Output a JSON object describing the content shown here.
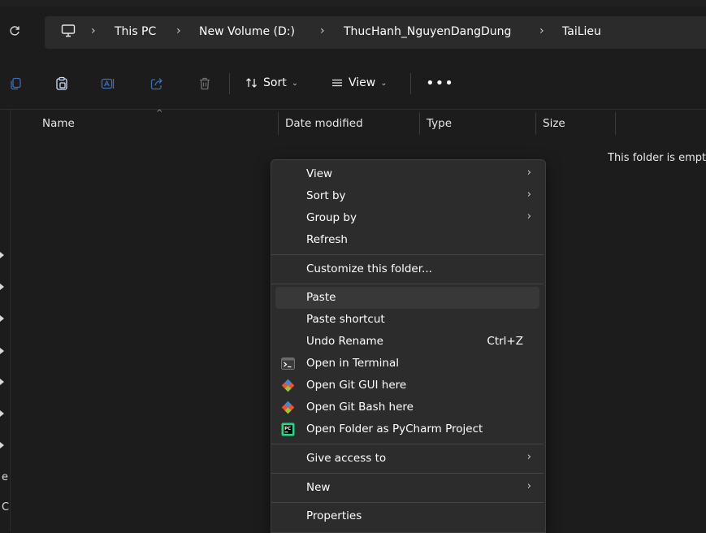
{
  "address": {
    "crumbs": [
      "This PC",
      "New Volume (D:)",
      "ThucHanh_NguyenDangDung",
      "TaiLieu"
    ]
  },
  "toolbar": {
    "sort_label": "Sort",
    "view_label": "View",
    "more_label": "•••"
  },
  "columns": {
    "name": "Name",
    "date_modified": "Date modified",
    "type": "Type",
    "size": "Size"
  },
  "content": {
    "empty_message": "This folder is empty."
  },
  "sidebar_fragments": [
    "e",
    "C"
  ],
  "context_menu": {
    "view": "View",
    "sort_by": "Sort by",
    "group_by": "Group by",
    "refresh": "Refresh",
    "customize": "Customize this folder...",
    "paste": "Paste",
    "paste_shortcut": "Paste shortcut",
    "undo_rename": "Undo Rename",
    "undo_shortcut": "Ctrl+Z",
    "open_terminal": "Open in Terminal",
    "open_git_gui": "Open Git GUI here",
    "open_git_bash": "Open Git Bash here",
    "open_pycharm": "Open Folder as PyCharm Project",
    "give_access": "Give access to",
    "new": "New",
    "properties": "Properties"
  },
  "colors": {
    "background": "#1c1c1c",
    "menu_bg": "#2c2c2c",
    "highlight": "#383838",
    "git_orange": "#f05133",
    "pycharm_green": "#21d789"
  }
}
